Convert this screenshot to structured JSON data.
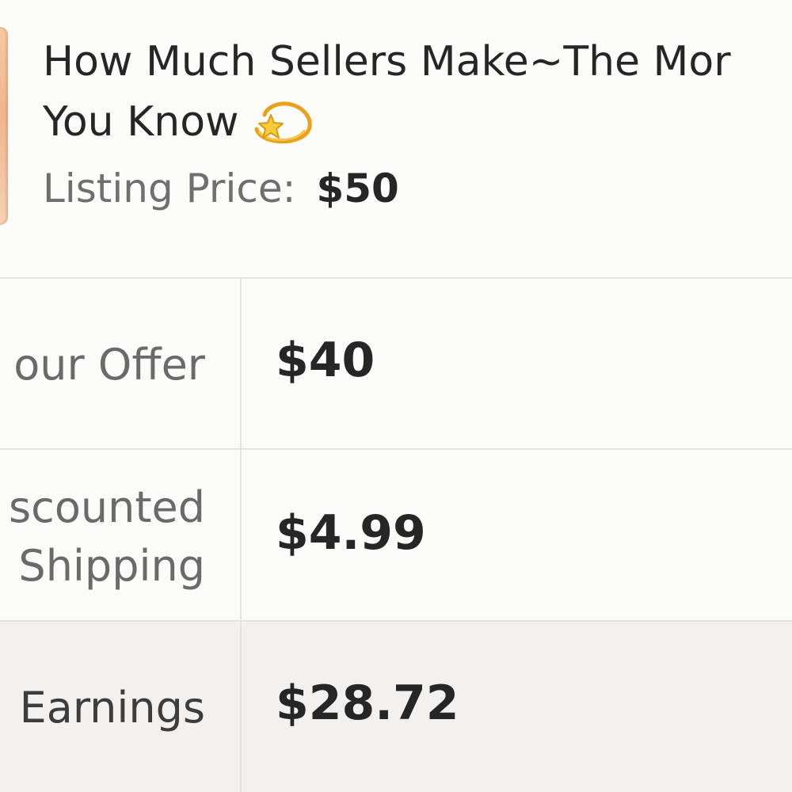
{
  "listing": {
    "title_line1": "How Much Sellers Make~The Mor",
    "title_line2": "You Know",
    "title_emoji": "dizzy-icon",
    "price_label": "Listing Price:",
    "price_value": "$50"
  },
  "rows": {
    "offer": {
      "label": "our Offer",
      "value": "$40"
    },
    "shipping": {
      "label_line1": "scounted",
      "label_line2": "Shipping",
      "value": "$4.99"
    },
    "earnings": {
      "label": "Earnings",
      "value": "$28.72"
    }
  },
  "colors": {
    "background": "#fbfbfa",
    "earnings_background": "#f2f1ef",
    "divider": "#e3e3e1",
    "text_dark": "#262626",
    "text_muted": "#6f6f6f"
  }
}
